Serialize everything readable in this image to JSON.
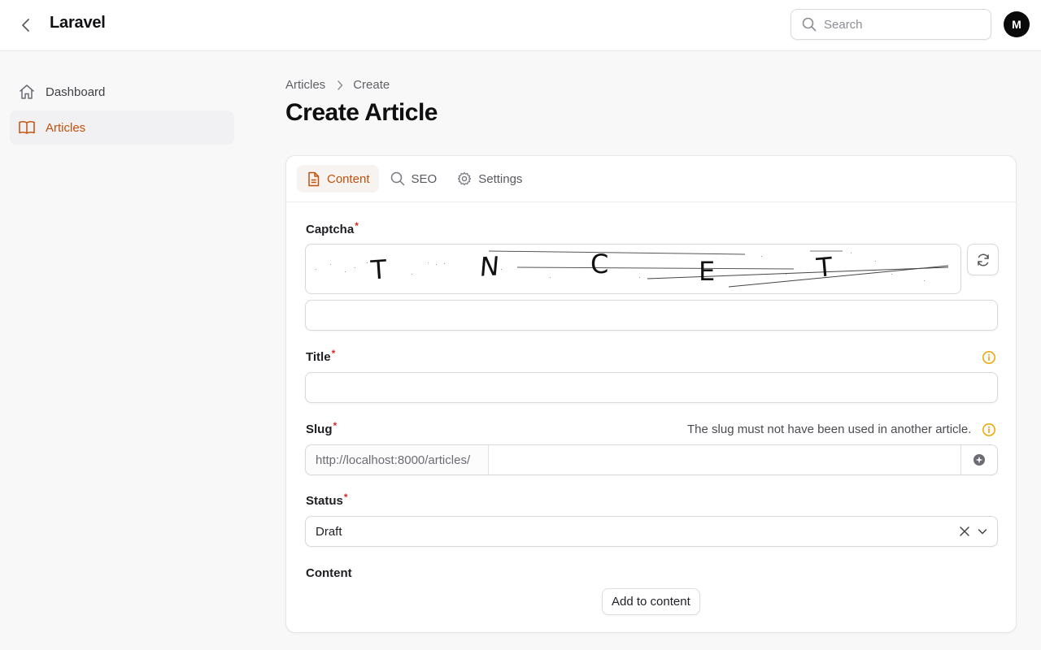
{
  "app": {
    "title": "Laravel",
    "user_initial": "M"
  },
  "search": {
    "placeholder": "Search"
  },
  "sidebar": {
    "items": [
      {
        "label": "Dashboard",
        "icon": "home-icon",
        "active": false
      },
      {
        "label": "Articles",
        "icon": "book-open-icon",
        "active": true
      }
    ]
  },
  "breadcrumb": {
    "items": [
      "Articles",
      "Create"
    ]
  },
  "page": {
    "title": "Create Article"
  },
  "tabs": [
    {
      "label": "Content",
      "icon": "document-icon",
      "active": true
    },
    {
      "label": "SEO",
      "icon": "search-icon",
      "active": false
    },
    {
      "label": "Settings",
      "icon": "gear-icon",
      "active": false
    }
  ],
  "form": {
    "captcha": {
      "label": "Captcha",
      "text": [
        "T",
        "N",
        "C",
        "E",
        "T"
      ],
      "value": ""
    },
    "title": {
      "label": "Title",
      "value": ""
    },
    "slug": {
      "label": "Slug",
      "hint": "The slug must not have been used in another article.",
      "prefix": "http://localhost:8000/articles/",
      "value": ""
    },
    "status": {
      "label": "Status",
      "value": "Draft"
    },
    "content": {
      "label": "Content",
      "add_label": "Add to content"
    }
  },
  "colors": {
    "accent": "#c2510c",
    "required": "#dc2626",
    "info": "#f0a500"
  }
}
